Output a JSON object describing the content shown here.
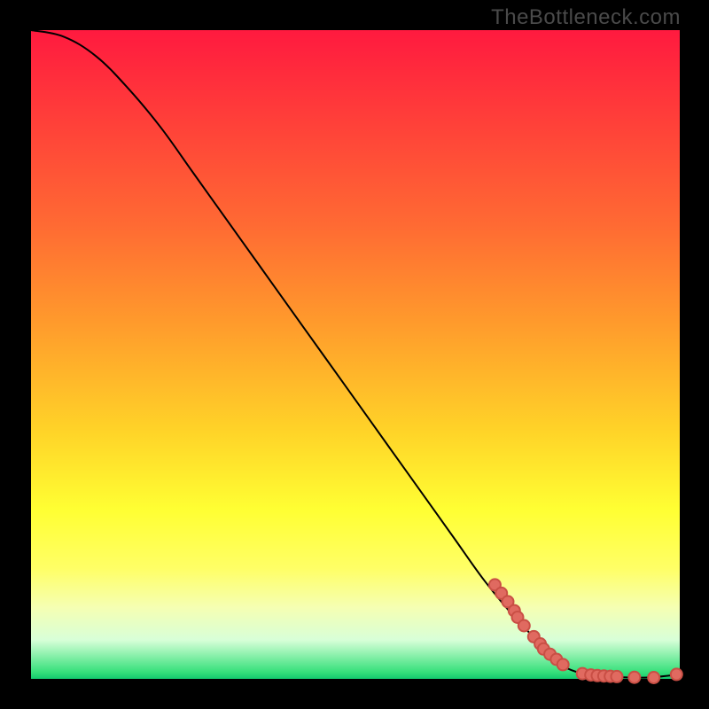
{
  "watermark": "TheBottleneck.com",
  "colors": {
    "background": "#000000",
    "dot_fill": "#e06a60",
    "dot_stroke": "#c94f45",
    "curve": "#000000"
  },
  "chart_data": {
    "type": "line",
    "title": "",
    "xlabel": "",
    "ylabel": "",
    "xlim": [
      0,
      100
    ],
    "ylim": [
      0,
      100
    ],
    "series": [
      {
        "name": "curve",
        "x": [
          0,
          5,
          10,
          15,
          20,
          25,
          30,
          35,
          40,
          45,
          50,
          55,
          60,
          65,
          70,
          75,
          80,
          82,
          85,
          88,
          90,
          95,
          100
        ],
        "y": [
          100,
          99,
          96,
          91,
          85,
          78,
          71,
          64,
          57,
          50,
          43,
          36,
          29,
          22,
          15,
          9,
          4,
          2,
          0.8,
          0.4,
          0.3,
          0.2,
          0.7
        ]
      }
    ],
    "annotations": {
      "dots_a": [
        {
          "x": 71.5,
          "y": 14.5
        },
        {
          "x": 72.5,
          "y": 13.2
        },
        {
          "x": 73.5,
          "y": 11.9
        },
        {
          "x": 74.5,
          "y": 10.5
        },
        {
          "x": 75.0,
          "y": 9.5
        },
        {
          "x": 76.0,
          "y": 8.2
        }
      ],
      "dots_b": [
        {
          "x": 77.5,
          "y": 6.5
        },
        {
          "x": 78.5,
          "y": 5.4
        },
        {
          "x": 79.0,
          "y": 4.6
        },
        {
          "x": 80.0,
          "y": 3.8
        },
        {
          "x": 81.0,
          "y": 3.0
        },
        {
          "x": 82.0,
          "y": 2.2
        }
      ],
      "dots_c": [
        {
          "x": 85.0,
          "y": 0.8
        },
        {
          "x": 86.3,
          "y": 0.6
        },
        {
          "x": 87.3,
          "y": 0.5
        },
        {
          "x": 88.3,
          "y": 0.45
        },
        {
          "x": 89.3,
          "y": 0.4
        },
        {
          "x": 90.3,
          "y": 0.35
        }
      ],
      "dots_d": [
        {
          "x": 93.0,
          "y": 0.25
        },
        {
          "x": 96.0,
          "y": 0.2
        },
        {
          "x": 99.5,
          "y": 0.7
        }
      ]
    },
    "gradient_stops": [
      {
        "pos": 0,
        "color": "#ff1a3f"
      },
      {
        "pos": 12,
        "color": "#ff3a3a"
      },
      {
        "pos": 30,
        "color": "#ff6a33"
      },
      {
        "pos": 45,
        "color": "#ff9a2c"
      },
      {
        "pos": 62,
        "color": "#ffd428"
      },
      {
        "pos": 74,
        "color": "#ffff33"
      },
      {
        "pos": 83,
        "color": "#ffff66"
      },
      {
        "pos": 89,
        "color": "#f5ffb3"
      },
      {
        "pos": 94,
        "color": "#d8ffd8"
      },
      {
        "pos": 99,
        "color": "#35e07a"
      },
      {
        "pos": 100,
        "color": "#13c96e"
      }
    ]
  }
}
